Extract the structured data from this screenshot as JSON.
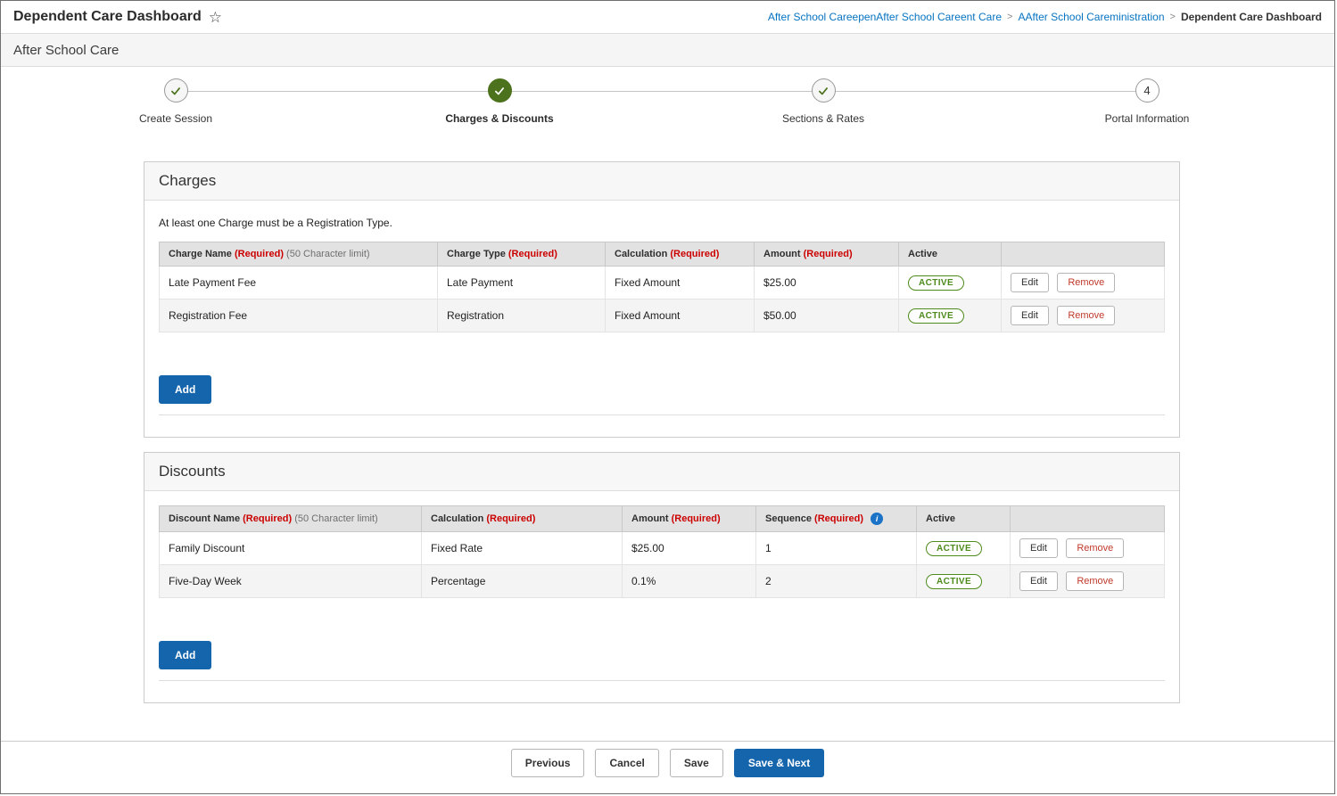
{
  "colors": {
    "accent_blue": "#1565ad",
    "link_blue": "#0673c1",
    "required_red": "#cc0000",
    "step_green": "#4c721d",
    "badge_green": "#4e8b1d"
  },
  "header": {
    "title": "Dependent Care Dashboard",
    "favorite_icon": "star-outline"
  },
  "breadcrumb": {
    "separator": ">",
    "items": [
      "After School CareepenAfter School Careent Care",
      "AAfter School Careministration",
      "Dependent Care Dashboard"
    ]
  },
  "page": {
    "section_title": "After School Care"
  },
  "stepper": {
    "steps": [
      {
        "label": "Create Session",
        "state": "complete",
        "icon": "check"
      },
      {
        "label": "Charges & Discounts",
        "state": "current",
        "icon": "check"
      },
      {
        "label": "Sections & Rates",
        "state": "complete",
        "icon": "check"
      },
      {
        "label": "Portal Information",
        "state": "upcoming",
        "number": "4"
      }
    ]
  },
  "actions": {
    "add": "Add",
    "edit": "Edit",
    "remove": "Remove"
  },
  "charges": {
    "title": "Charges",
    "note": "At least one Charge must be a Registration Type.",
    "columns": [
      {
        "label": "Charge Name",
        "required": "(Required)",
        "note": "(50 Character limit)"
      },
      {
        "label": "Charge Type",
        "required": "(Required)",
        "note": ""
      },
      {
        "label": "Calculation",
        "required": "(Required)",
        "note": ""
      },
      {
        "label": "Amount",
        "required": "(Required)",
        "note": ""
      },
      {
        "label": "Active",
        "required": "",
        "note": ""
      }
    ],
    "rows": [
      {
        "name": "Late Payment Fee",
        "type": "Late Payment",
        "calculation": "Fixed Amount",
        "amount": "$25.00",
        "status": "ACTIVE"
      },
      {
        "name": "Registration Fee",
        "type": "Registration",
        "calculation": "Fixed Amount",
        "amount": "$50.00",
        "status": "ACTIVE"
      }
    ]
  },
  "discounts": {
    "title": "Discounts",
    "info_icon": "i",
    "columns": [
      {
        "label": "Discount Name",
        "required": "(Required)",
        "note": "(50 Character limit)"
      },
      {
        "label": "Calculation",
        "required": "(Required)",
        "note": ""
      },
      {
        "label": "Amount",
        "required": "(Required)",
        "note": ""
      },
      {
        "label": "Sequence",
        "required": "(Required)",
        "note": ""
      },
      {
        "label": "Active",
        "required": "",
        "note": ""
      }
    ],
    "rows": [
      {
        "name": "Family Discount",
        "calculation": "Fixed Rate",
        "amount": "$25.00",
        "sequence": "1",
        "status": "ACTIVE"
      },
      {
        "name": "Five-Day Week",
        "calculation": "Percentage",
        "amount": "0.1%",
        "sequence": "2",
        "status": "ACTIVE"
      }
    ]
  },
  "footer": {
    "previous": "Previous",
    "cancel": "Cancel",
    "save": "Save",
    "save_next": "Save & Next"
  }
}
